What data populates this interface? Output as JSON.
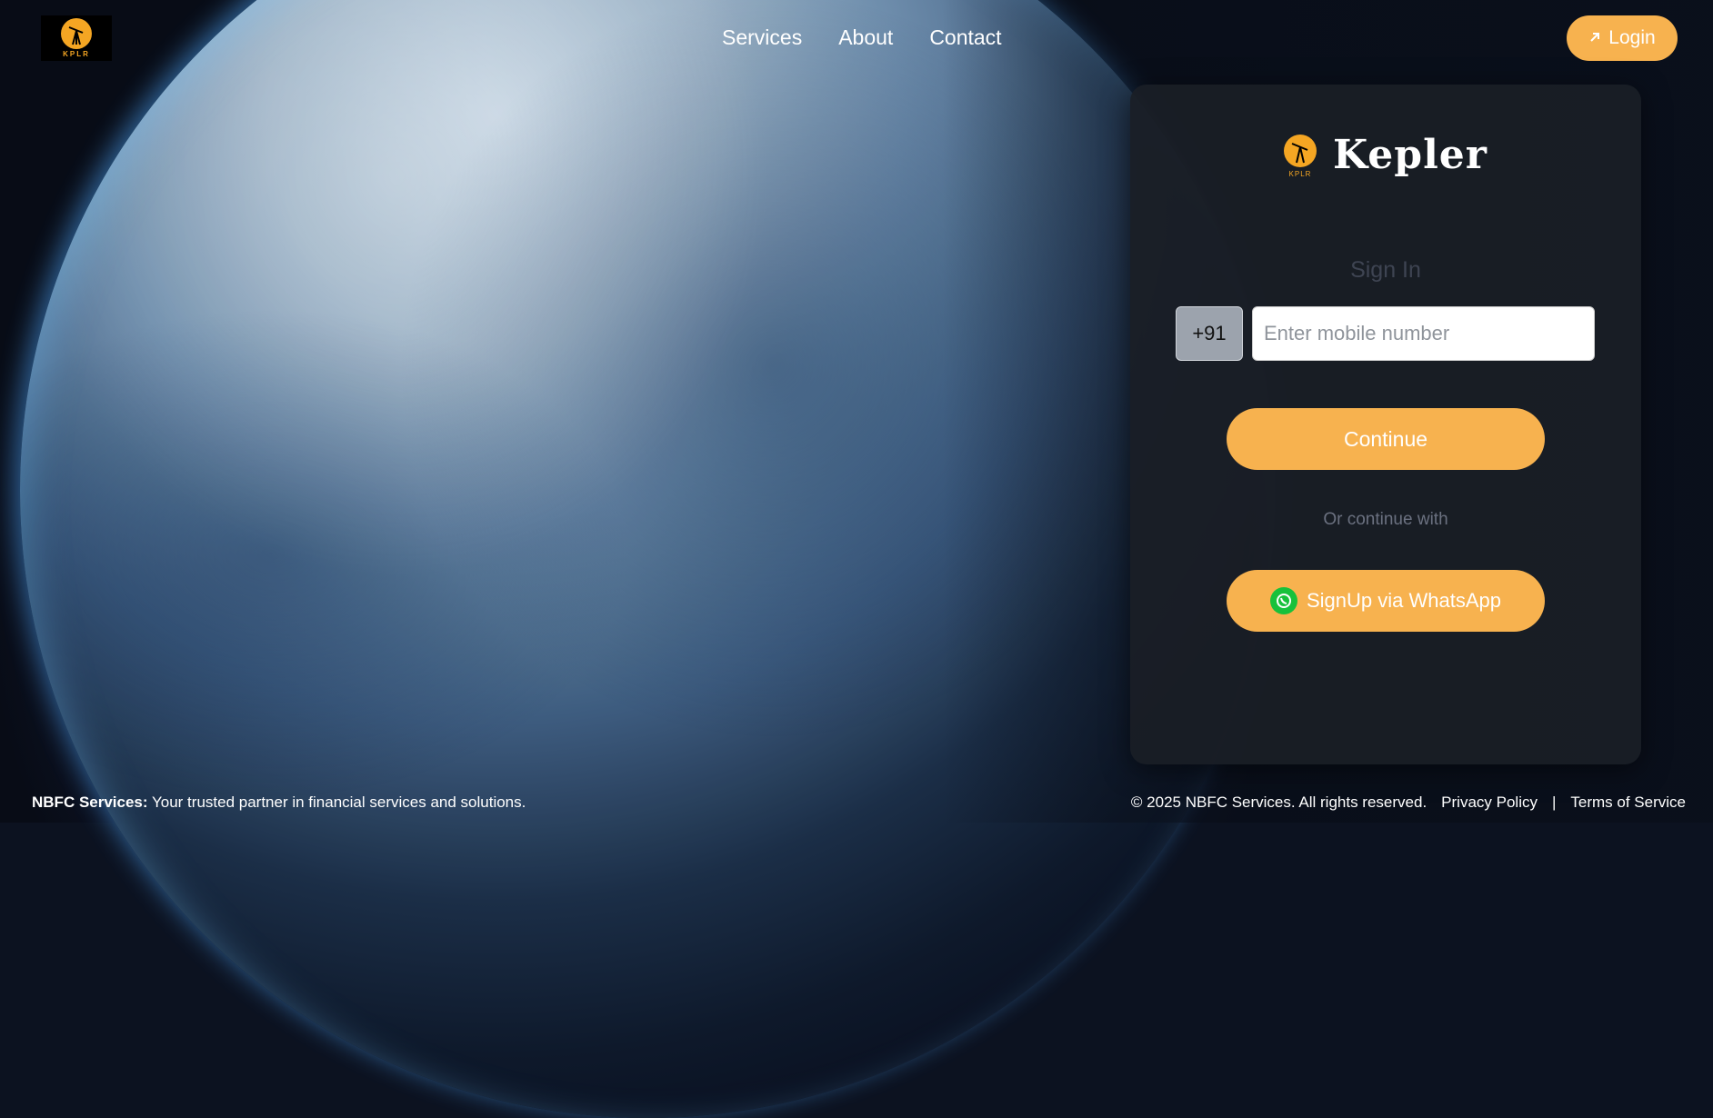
{
  "header": {
    "logo_text": "KPLR",
    "nav": [
      "Services",
      "About",
      "Contact"
    ],
    "login_label": "Login"
  },
  "card": {
    "brand_name": "Kepler",
    "brand_logo_text": "KPLR",
    "title": "Sign In",
    "country_code": "+91",
    "mobile_placeholder": "Enter mobile number",
    "mobile_value": "",
    "continue_label": "Continue",
    "or_text": "Or continue with",
    "whatsapp_label": "SignUp via WhatsApp"
  },
  "footer": {
    "brand_bold": "NBFC Services:",
    "tagline": "Your trusted partner in financial services and solutions.",
    "copyright": "© 2025 NBFC Services. All rights reserved.",
    "privacy": "Privacy Policy",
    "separator": "|",
    "terms": "Terms of Service"
  },
  "colors": {
    "accent": "#f7b24f",
    "whatsapp": "#17c13b",
    "card_bg": "#1a1e26"
  },
  "icons": [
    "telescope-icon",
    "arrow-up-right-icon",
    "whatsapp-icon"
  ]
}
